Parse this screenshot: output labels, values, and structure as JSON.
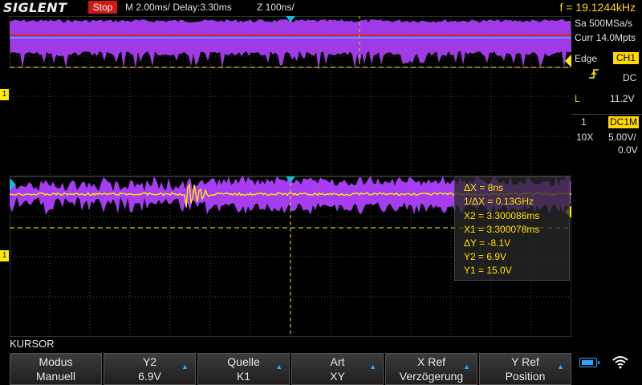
{
  "header": {
    "brand": "SIGLENT",
    "status": "Stop",
    "timebase": "M 2.00ms/ Delay:3.30ms",
    "zoom": "Z 100ns/",
    "frequency": "f = 19.1244kHz"
  },
  "acquisition": {
    "sample_rate": "Sa 500MSa/s",
    "memory_depth": "Curr 14.0Mpts"
  },
  "trigger": {
    "type": "Edge",
    "source": "CH1",
    "slope_icon": "rising-edge-icon",
    "coupling": "DC",
    "level_label": "L",
    "level": "11.2V"
  },
  "channel1": {
    "number": "1",
    "coupling": "DC1M",
    "probe": "10X",
    "scale": "5.00V/",
    "offset": "0.0V"
  },
  "cursor_readout": {
    "delta_x": "ΔX = 8ns",
    "inv_delta_x": "1/ΔX = 0.13GHz",
    "x2": "X2 = 3.300086ms",
    "x1": "X1 = 3.300078ms",
    "delta_y": "ΔY = -8.1V",
    "y2": "Y2 = 6.9V",
    "y1": "Y1 = 15.0V"
  },
  "menu_title": "KURSOR",
  "softkeys": [
    {
      "line1": "Modus",
      "line2": "Manuell",
      "has_arrow": false
    },
    {
      "line1": "Y2",
      "line2": "6.9V",
      "has_arrow": true
    },
    {
      "line1": "Quelle",
      "line2": "K1",
      "has_arrow": true
    },
    {
      "line1": "Art",
      "line2": "XY",
      "has_arrow": true
    },
    {
      "line1": "X Ref",
      "line2": "Verzögerung",
      "has_arrow": true
    },
    {
      "line1": "Y Ref",
      "line2": "Position",
      "has_arrow": true
    }
  ],
  "markers": {
    "ch1_ground_top": "1",
    "ch1_ground_bottom": "1"
  },
  "colors": {
    "background": "#000000",
    "grid": "#4a4a4a",
    "channel1": "#ffee00",
    "math_trace": "#b040ff",
    "cursor_line": "#d8c800",
    "trigger_marker": "#18b8d8",
    "red_line": "#e02020",
    "status_stop": "#d01818",
    "softkey_arrow": "#2aa6ff"
  },
  "system_icons": [
    "battery-icon",
    "wifi-icon"
  ]
}
